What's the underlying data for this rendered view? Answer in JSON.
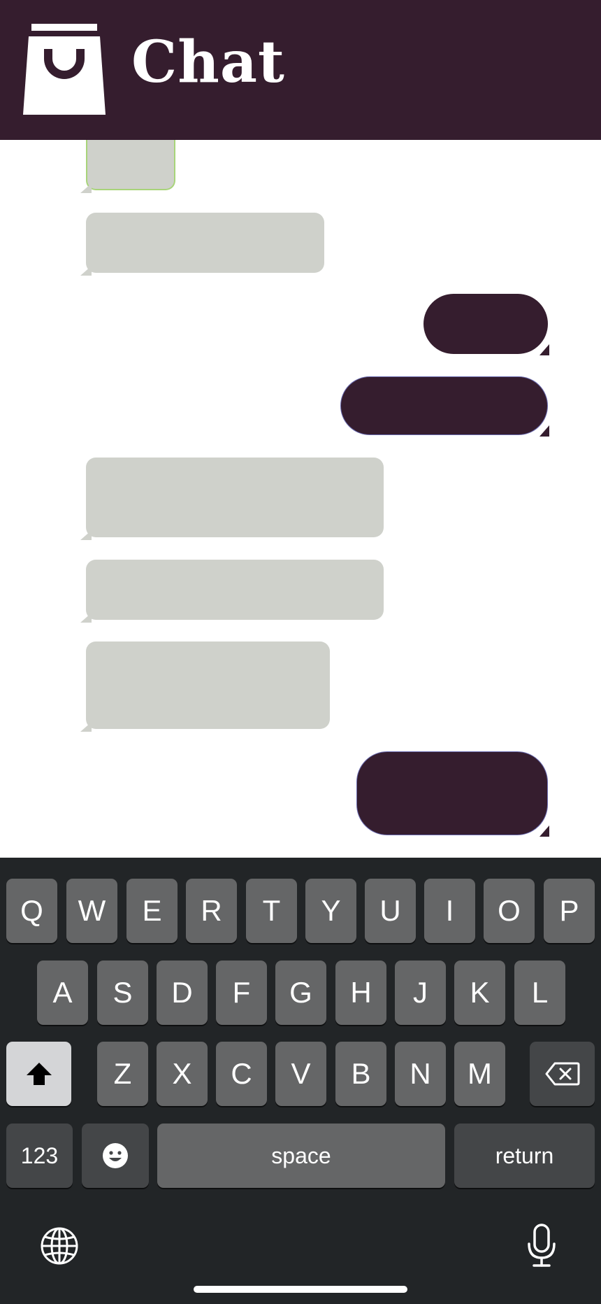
{
  "header": {
    "title": "Chat",
    "background": "#351d2e",
    "logo_icon": "shopping-bag-icon"
  },
  "messages": [
    {
      "direction": "incoming",
      "text": ""
    },
    {
      "direction": "incoming",
      "text": ""
    },
    {
      "direction": "outgoing",
      "text": ""
    },
    {
      "direction": "outgoing",
      "text": ""
    },
    {
      "direction": "incoming",
      "text": ""
    },
    {
      "direction": "incoming",
      "text": ""
    },
    {
      "direction": "incoming",
      "text": ""
    },
    {
      "direction": "outgoing",
      "text": ""
    }
  ],
  "colors": {
    "incoming_bubble": "#cfd1cb",
    "outgoing_bubble": "#351d2e",
    "keyboard_bg": "#222527"
  },
  "keyboard": {
    "row1": [
      "Q",
      "W",
      "E",
      "R",
      "T",
      "Y",
      "U",
      "I",
      "O",
      "P"
    ],
    "row2": [
      "A",
      "S",
      "D",
      "F",
      "G",
      "H",
      "J",
      "K",
      "L"
    ],
    "row3": [
      "Z",
      "X",
      "C",
      "V",
      "B",
      "N",
      "M"
    ],
    "numbers_key": "123",
    "space_key": "space",
    "return_key": "return",
    "shift_icon": "shift-icon",
    "backspace_icon": "backspace-icon",
    "emoji_icon": "emoji-icon",
    "globe_icon": "globe-icon",
    "mic_icon": "microphone-icon"
  }
}
